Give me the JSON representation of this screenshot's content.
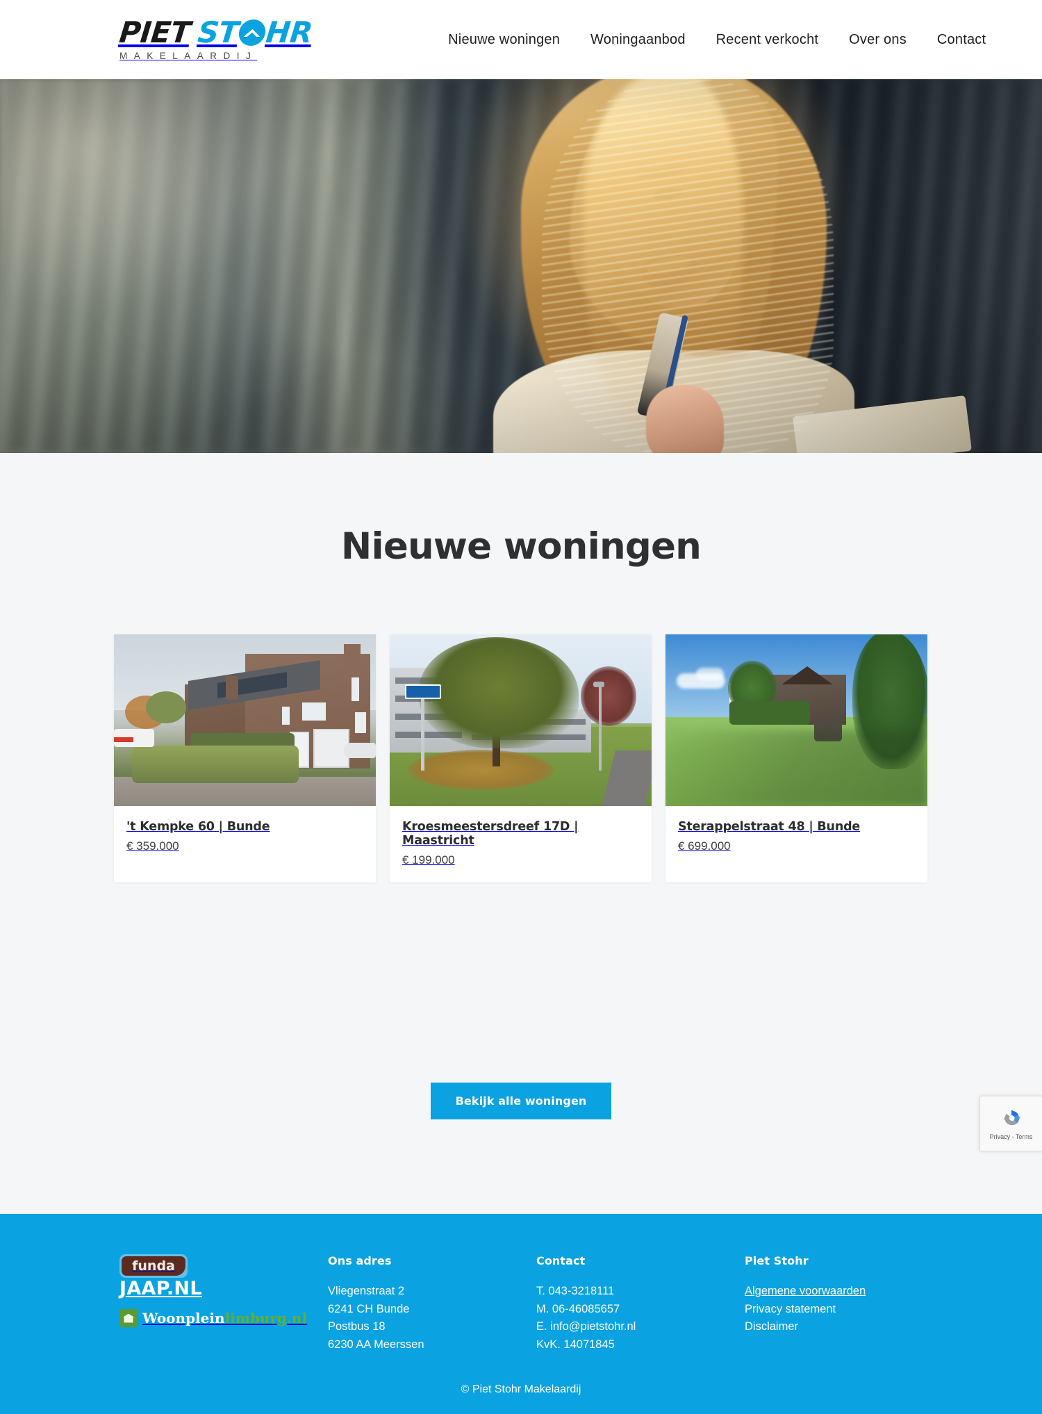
{
  "header": {
    "logo": {
      "part1": "PIET",
      "part2": "ST",
      "part3": "HR",
      "subtitle": "MAKELAARDIJ",
      "icon": "house-chevron-icon"
    },
    "nav": [
      {
        "label": "Nieuwe woningen"
      },
      {
        "label": "Woningaanbod"
      },
      {
        "label": "Recent verkocht"
      },
      {
        "label": "Over ons"
      },
      {
        "label": "Contact"
      }
    ]
  },
  "hero": {
    "alt": "Smiling woman with phone outdoors in golden sunlight"
  },
  "main": {
    "title": "Nieuwe woningen",
    "cards": [
      {
        "title": "'t Kempke 60 | Bunde",
        "price": "€ 359.000"
      },
      {
        "title": "Kroesmeestersdreef 17D | Maastricht",
        "price": "€ 199.000"
      },
      {
        "title": "Sterappelstraat 48 | Bunde",
        "price": "€ 699.000"
      }
    ],
    "cta_label": "Bekijk alle woningen"
  },
  "recaptcha": {
    "label": "Privacy - Terms",
    "icon": "recaptcha-icon"
  },
  "footer": {
    "logos": {
      "funda": "funda",
      "jaap": "JAAP.NL",
      "woonplein_a": "Woonplein",
      "woonplein_b": "limburg.nl"
    },
    "address": {
      "heading": "Ons adres",
      "line1": "Vliegenstraat 2",
      "line2": "6241 CH Bunde",
      "line3": "Postbus 18",
      "line4": "6230 AA Meerssen"
    },
    "contact": {
      "heading": "Contact",
      "line1": "T. 043-3218111",
      "line2": "M. 06-46085657",
      "line3": "E. info@pietstohr.nl",
      "line4": "KvK. 14071845"
    },
    "links": {
      "heading": "Piet Stohr",
      "link1": "Algemene voorwaarden",
      "link2": "Privacy statement",
      "link3": "Disclaimer"
    },
    "copyright": "© Piet Stohr Makelaardij"
  },
  "colors": {
    "brand_blue": "#0aa2e0",
    "page_bg": "#f5f6f7",
    "text_dark": "#2e3033"
  }
}
